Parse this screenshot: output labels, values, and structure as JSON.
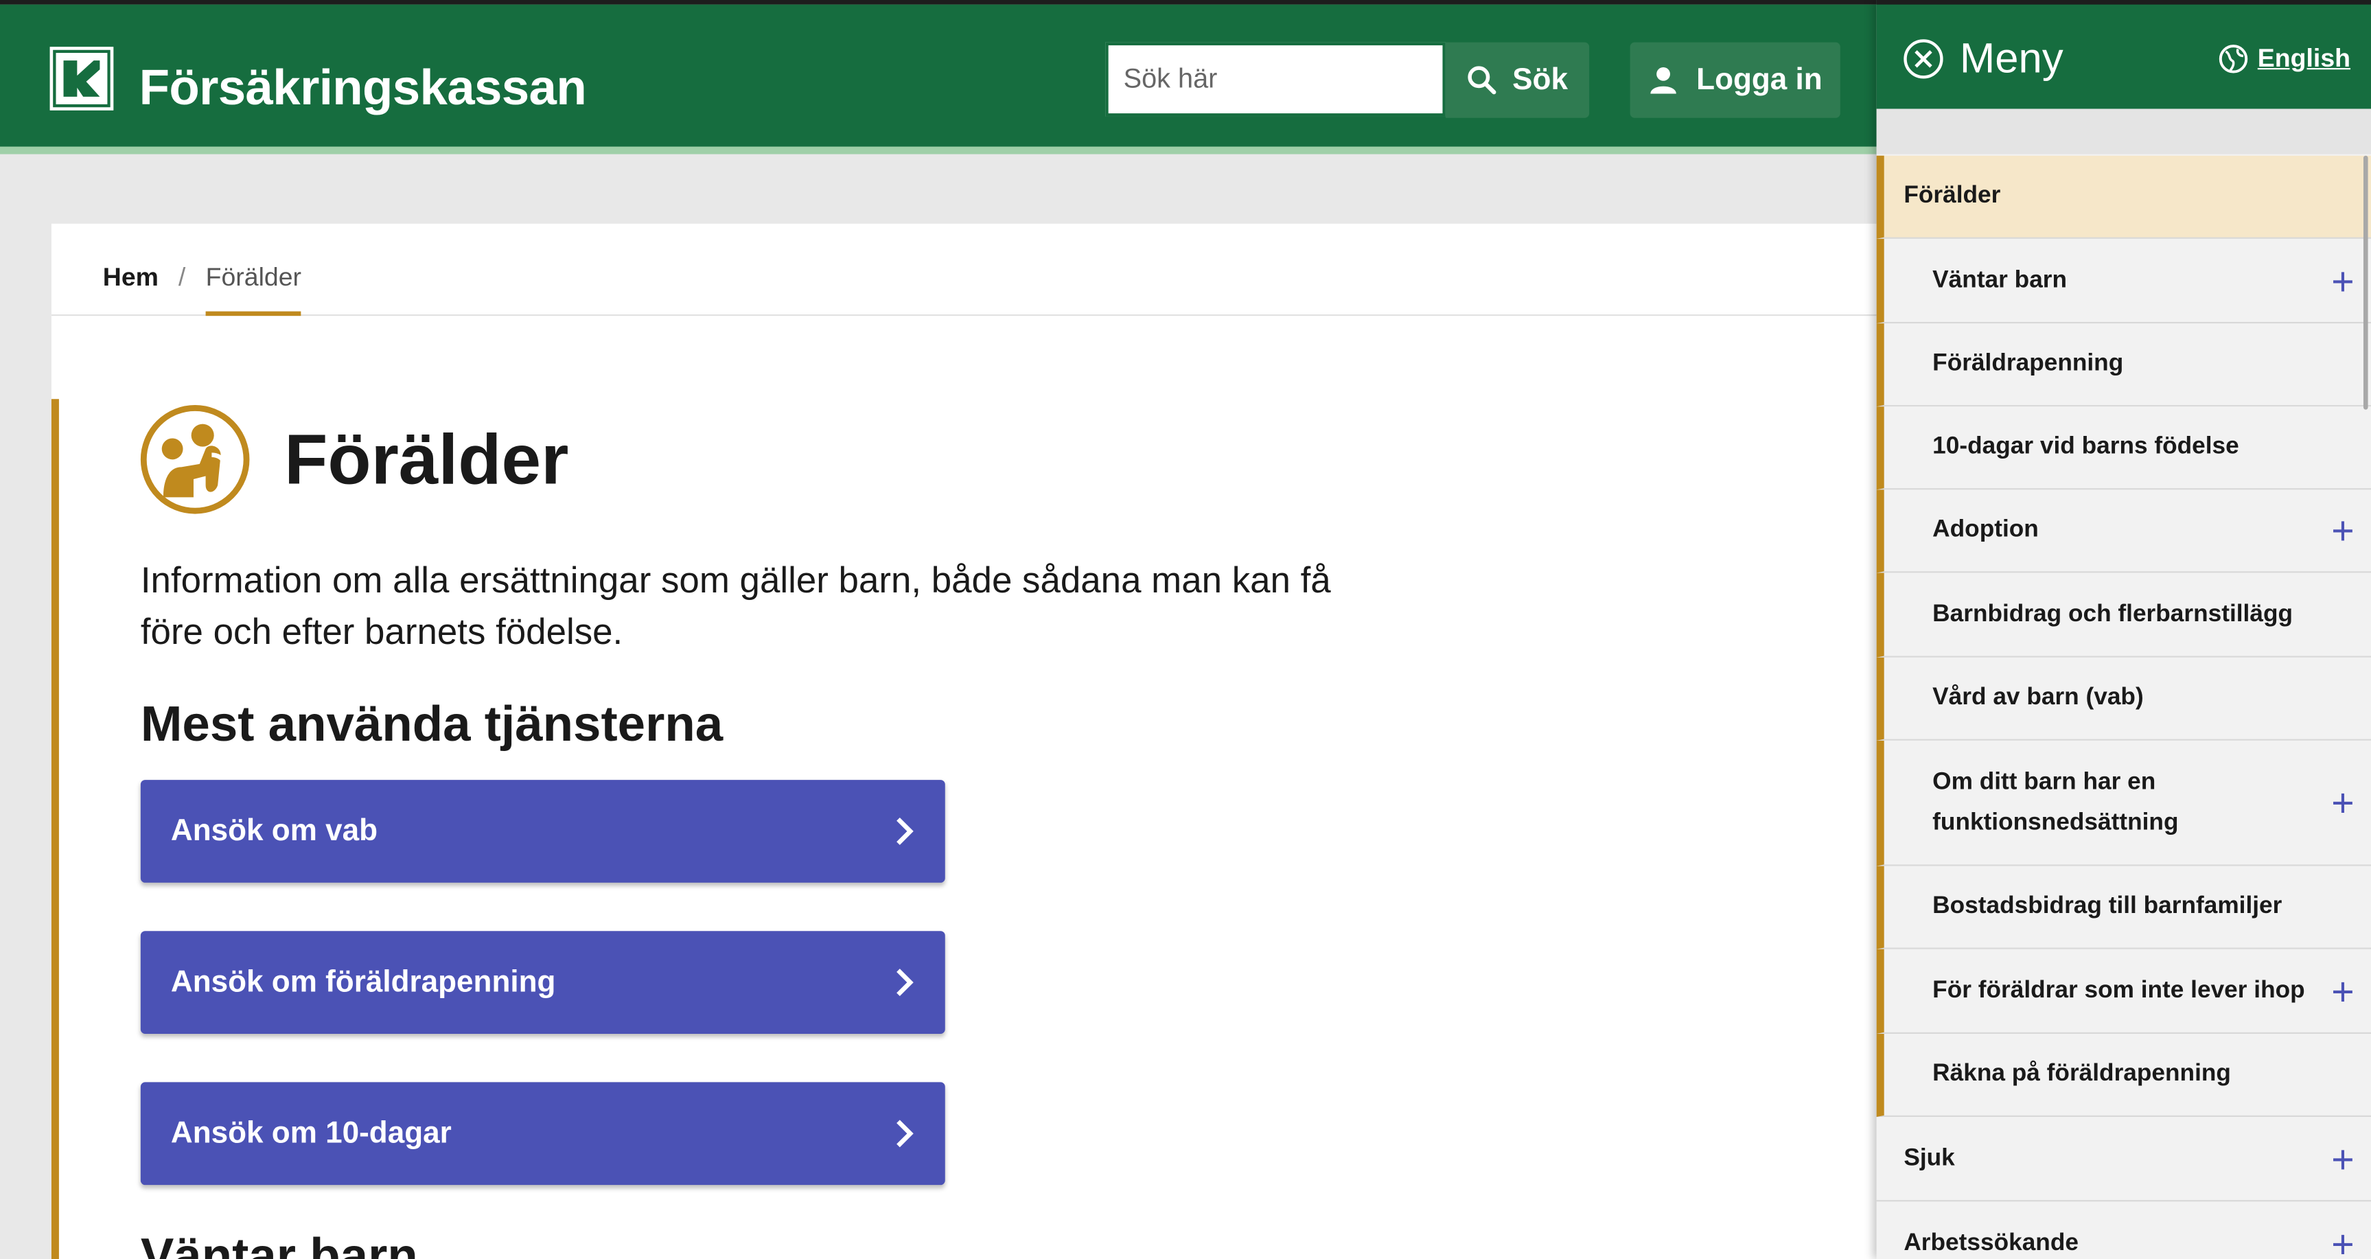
{
  "header": {
    "logo_text": "Försäkringskassan",
    "search_placeholder": "Sök här",
    "search_button": "Sök",
    "login_button": "Logga in"
  },
  "breadcrumb": {
    "home": "Hem",
    "separator": "/",
    "current": "Förälder"
  },
  "main": {
    "title": "Förälder",
    "intro": "Information om alla ersättningar som gäller barn, både sådana man kan få före och efter barnets födelse.",
    "section_title": "Mest använda tjänsterna",
    "services": [
      {
        "label": "Ansök om vab"
      },
      {
        "label": "Ansök om föräldrapenning"
      },
      {
        "label": "Ansök om 10-dagar"
      }
    ],
    "next_section_title": "Väntar barn"
  },
  "menu": {
    "title": "Meny",
    "language": "English",
    "items": [
      {
        "label": "Förälder",
        "level": "active",
        "expandable": false
      },
      {
        "label": "Väntar barn",
        "level": "sub",
        "expandable": true
      },
      {
        "label": "Föräldrapenning",
        "level": "sub",
        "expandable": false
      },
      {
        "label": "10-dagar vid barns födelse",
        "level": "sub",
        "expandable": false
      },
      {
        "label": "Adoption",
        "level": "sub",
        "expandable": true
      },
      {
        "label": "Barnbidrag och flerbarnstillägg",
        "level": "sub",
        "expandable": false
      },
      {
        "label": "Vård av barn (vab)",
        "level": "sub",
        "expandable": false
      },
      {
        "label": "Om ditt barn har en funktionsnedsättning",
        "level": "sub",
        "expandable": true
      },
      {
        "label": "Bostadsbidrag till barnfamiljer",
        "level": "sub",
        "expandable": false
      },
      {
        "label": "För föräldrar som inte lever ihop",
        "level": "sub",
        "expandable": true
      },
      {
        "label": "Räkna på föräldrapenning",
        "level": "sub",
        "expandable": false
      },
      {
        "label": "Sjuk",
        "level": "top",
        "expandable": true
      },
      {
        "label": "Arbetssökande",
        "level": "top",
        "expandable": true
      }
    ],
    "plus_symbol": "+"
  },
  "colors": {
    "brand_green": "#166d3f",
    "accent_gold": "#c08a1e",
    "button_blue": "#4b52b5",
    "active_bg": "#f6e7c9"
  }
}
